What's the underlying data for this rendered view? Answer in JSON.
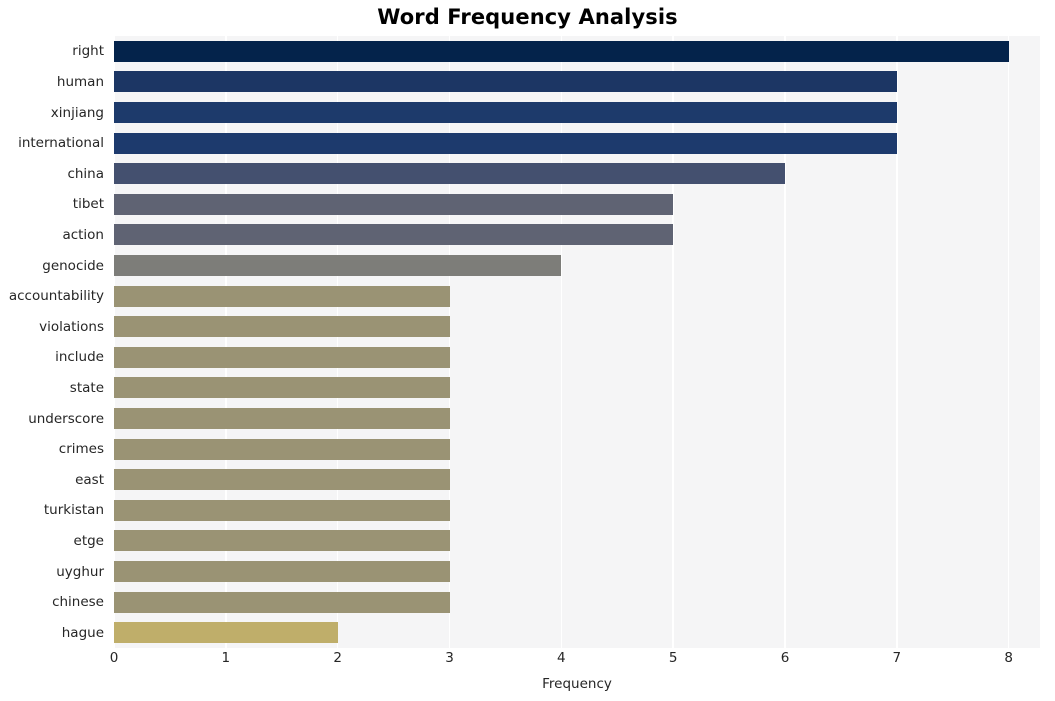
{
  "chart_data": {
    "type": "bar",
    "orientation": "horizontal",
    "title": "Word Frequency Analysis",
    "xlabel": "Frequency",
    "ylabel": "",
    "xlim": [
      0,
      8.28
    ],
    "xticks": [
      0,
      1,
      2,
      3,
      4,
      5,
      6,
      7,
      8
    ],
    "xtick_labels": [
      "0",
      "1",
      "2",
      "3",
      "4",
      "5",
      "6",
      "7",
      "8"
    ],
    "grid": "vertical",
    "legend": "none",
    "categories": [
      "right",
      "human",
      "xinjiang",
      "international",
      "china",
      "tibet",
      "action",
      "genocide",
      "accountability",
      "violations",
      "include",
      "state",
      "underscore",
      "crimes",
      "east",
      "turkistan",
      "etge",
      "uyghur",
      "chinese",
      "hague"
    ],
    "values": [
      8,
      7,
      7,
      7,
      6,
      5,
      5,
      4,
      3,
      3,
      3,
      3,
      3,
      3,
      3,
      3,
      3,
      3,
      3,
      2
    ],
    "bar_colors": [
      "#04234b",
      "#1c3664",
      "#1d3a6b",
      "#1d3a6d",
      "#44506f",
      "#5f6373",
      "#5f6373",
      "#7d7d79",
      "#9a9374",
      "#9a9374",
      "#9a9374",
      "#9a9374",
      "#9a9374",
      "#9a9374",
      "#9a9374",
      "#9a9374",
      "#9a9374",
      "#9a9374",
      "#9a9374",
      "#bfae6a"
    ],
    "plot_background": "#f5f5f6",
    "gridline_color": "#ffffff",
    "figure_background": "#ffffff",
    "text_color": "#262626"
  }
}
